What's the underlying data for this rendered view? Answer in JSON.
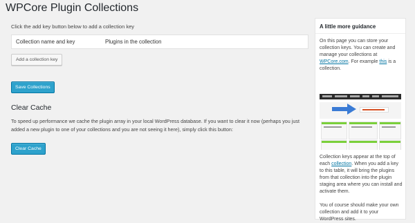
{
  "page": {
    "title": "WPCore Plugin Collections"
  },
  "main": {
    "instruction": "Click the add key button below to add a collection key",
    "table": {
      "col_key": "Collection name and key",
      "col_plugins": "Plugins in the collection"
    },
    "add_key_label": "Add a collection key",
    "save_label": "Save Collections",
    "clear_cache": {
      "heading": "Clear Cache",
      "text": "To speed up performance we cache the plugin array in your local WordPress database. If you want to clear it now (perhaps you just added a new plugin to one of your collections and you are not seeing it here), simply click this button:",
      "button_label": "Clear Cache"
    }
  },
  "sidebar": {
    "title": "A little more guidance",
    "p1_a": "On this page you can store your collection keys. You can create and manage your collections at ",
    "p1_link1": "WPCore.com",
    "p1_b": ". For example ",
    "p1_link2": "this",
    "p1_c": " is a collection.",
    "p2_a": "Collection keys appear at the top of each ",
    "p2_link": "collection",
    "p2_b": ". When you add a key to this table, it will bring the plugins from that collection into the plugin staging area where you can install and activate them.",
    "p3": "You of course should make your own collection and add it to your WordPress sites."
  },
  "colors": {
    "primary": "#2ea2cc",
    "link": "#0074a2",
    "background": "#f1f1f1"
  }
}
